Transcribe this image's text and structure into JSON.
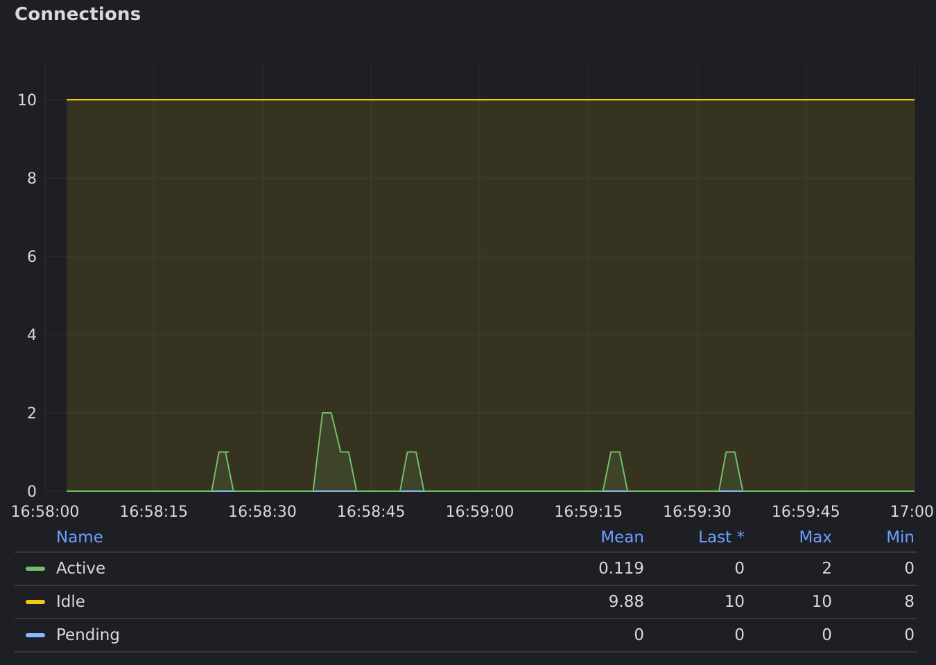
{
  "panel": {
    "title": "Connections"
  },
  "colors": {
    "Active": "#73bf69",
    "Idle": "#f2cc0c",
    "Pending": "#8ab8ff",
    "grid": "#2f312a",
    "axis_text": "#d8d9da",
    "legend_header": "#6e9fff"
  },
  "chart_data": {
    "type": "line",
    "y_ticks": [
      "0",
      "2",
      "4",
      "6",
      "8",
      "10"
    ],
    "ylim": [
      0,
      11
    ],
    "x_ticks": [
      "16:58:00",
      "16:58:15",
      "16:58:30",
      "16:58:45",
      "16:59:00",
      "16:59:15",
      "16:59:30",
      "16:59:45",
      "17:00:"
    ],
    "x_tick_seconds": [
      0,
      15,
      30,
      45,
      60,
      75,
      90,
      105,
      120
    ],
    "xlim_seconds": [
      0,
      120
    ],
    "grid": true,
    "legend_position": "bottom",
    "series": [
      {
        "name": "Pending",
        "color": "#8ab8ff",
        "points": [
          [
            3,
            0
          ],
          [
            120,
            0
          ]
        ]
      },
      {
        "name": "Idle",
        "color": "#f2cc0c",
        "points": [
          [
            3,
            10
          ],
          [
            120,
            10
          ]
        ]
      },
      {
        "name": "Active",
        "color": "#73bf69",
        "points": [
          [
            3,
            0
          ],
          [
            23,
            0
          ],
          [
            24,
            1
          ],
          [
            25.3,
            1
          ],
          [
            24.9,
            1
          ],
          [
            26,
            0
          ],
          [
            37,
            0
          ],
          [
            38.3,
            2
          ],
          [
            39.5,
            2
          ],
          [
            40.8,
            1
          ],
          [
            41.9,
            1
          ],
          [
            43,
            0
          ],
          [
            49,
            0
          ],
          [
            50,
            1
          ],
          [
            51.2,
            1
          ],
          [
            52.3,
            0
          ],
          [
            77,
            0
          ],
          [
            78.1,
            1
          ],
          [
            79.3,
            1
          ],
          [
            80.4,
            0
          ],
          [
            93,
            0
          ],
          [
            94,
            1
          ],
          [
            95.2,
            1
          ],
          [
            96.3,
            0
          ],
          [
            120,
            0
          ]
        ]
      }
    ]
  },
  "legend": {
    "headers": {
      "name": "Name",
      "mean": "Mean",
      "last": "Last *",
      "max": "Max",
      "min": "Min"
    },
    "rows": [
      {
        "name": "Active",
        "color": "#73bf69",
        "mean": "0.119",
        "last": "0",
        "max": "2",
        "min": "0"
      },
      {
        "name": "Idle",
        "color": "#f2cc0c",
        "mean": "9.88",
        "last": "10",
        "max": "10",
        "min": "8"
      },
      {
        "name": "Pending",
        "color": "#8ab8ff",
        "mean": "0",
        "last": "0",
        "max": "0",
        "min": "0"
      }
    ]
  }
}
